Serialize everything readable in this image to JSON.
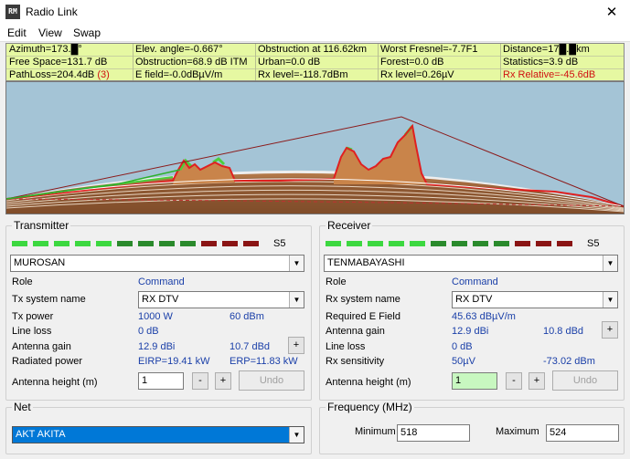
{
  "window": {
    "icon": "app-logo-icon",
    "title": "Radio Link",
    "close": "✕"
  },
  "menu": [
    "Edit",
    "View",
    "Swap"
  ],
  "info": {
    "row1": [
      "Azimuth=173.█°",
      "Elev. angle=-0.667°",
      "Obstruction at 116.62km",
      "Worst Fresnel=-7.7F1",
      "Distance=17█.█km"
    ],
    "row2": [
      "Free Space=131.7 dB",
      "Obstruction=68.9 dB ITM",
      "Urban=0.0 dB",
      "Forest=0.0 dB",
      "Statistics=3.9 dB"
    ],
    "row3_pathloss": "PathLoss=204.4dB",
    "row3_pathloss_mode": "(3)",
    "row3": [
      "E field=-0.0dBµV/m",
      "Rx level=-118.7dBm",
      "Rx level=0.26µV"
    ],
    "row3_relative": "Rx Relative=-45.6dB"
  },
  "colors": {
    "info_bg": "#e6f8a2",
    "sky": "#a4c4d6",
    "terrain": "#c9844a",
    "link_line": "#8b1a1a",
    "accent_value": "#1a3fa8"
  },
  "transmitter": {
    "title": "Transmitter",
    "signal_label": "S5",
    "signal_levels": 5,
    "signal_segments": 12,
    "station": "MUROSAN",
    "role_label": "Role",
    "role_value": "Command",
    "system_label": "Tx system name",
    "system_value": "RX DTV",
    "power_label": "Tx power",
    "power_w": "1000 W",
    "power_dbm": "60 dBm",
    "line_loss_label": "Line loss",
    "line_loss_value": "0 dB",
    "gain_label": "Antenna gain",
    "gain_dbi": "12.9 dBi",
    "gain_dbd": "10.7 dBd",
    "radiated_label": "Radiated power",
    "eirp": "EIRP=19.41 kW",
    "erp": "ERP=11.83 kW",
    "height_label": "Antenna height (m)",
    "height_value": "1",
    "minus": "-",
    "plus": "+",
    "undo": "Undo"
  },
  "receiver": {
    "title": "Receiver",
    "signal_label": "S5",
    "signal_levels": 5,
    "signal_segments": 12,
    "station": "TENMABAYASHI",
    "role_label": "Role",
    "role_value": "Command",
    "system_label": "Rx system name",
    "system_value": "RX DTV",
    "efield_label": "Required E Field",
    "efield_value": "45.63 dBµV/m",
    "gain_label": "Antenna gain",
    "gain_dbi": "12.9 dBi",
    "gain_dbd": "10.8 dBd",
    "line_loss_label": "Line loss",
    "line_loss_value": "0 dB",
    "sens_label": "Rx sensitivity",
    "sens_uv": "50µV",
    "sens_dbm": "-73.02 dBm",
    "height_label": "Antenna height (m)",
    "height_value": "1",
    "minus": "-",
    "plus": "+",
    "undo": "Undo"
  },
  "net": {
    "title": "Net",
    "value": "AKT AKITA"
  },
  "frequency": {
    "title": "Frequency (MHz)",
    "min_label": "Minimum",
    "min_value": "518",
    "max_label": "Maximum",
    "max_value": "524"
  }
}
